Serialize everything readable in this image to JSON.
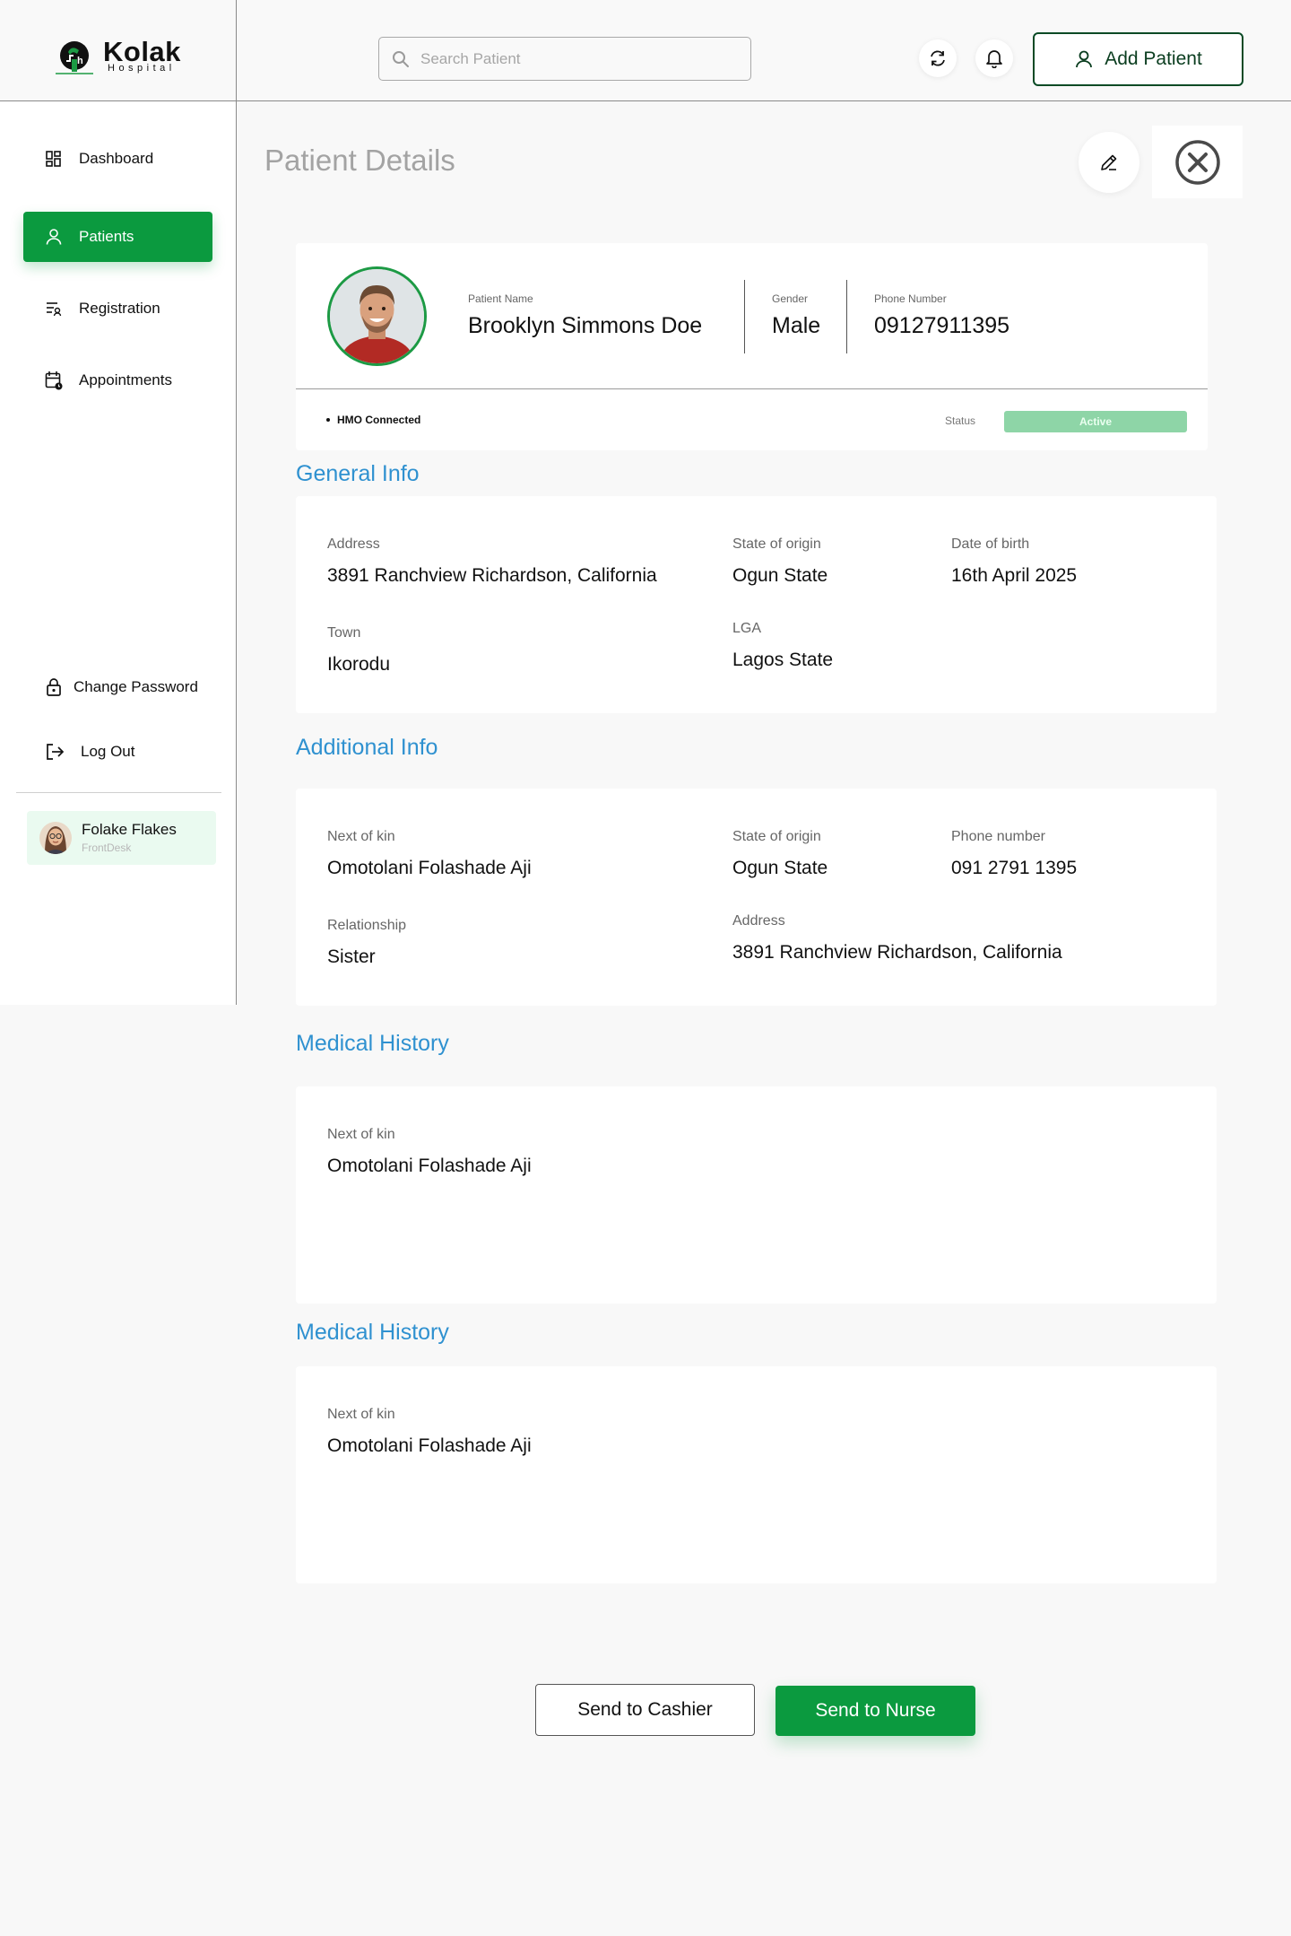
{
  "brand": {
    "name": "Kolak",
    "subtitle": "Hospital",
    "accent": "#0b9a3f"
  },
  "header": {
    "search_placeholder": "Search Patient",
    "add_patient_label": "Add Patient"
  },
  "sidebar": {
    "items": [
      {
        "label": "Dashboard",
        "icon": "dashboard-icon"
      },
      {
        "label": "Patients",
        "icon": "user-icon",
        "active": true
      },
      {
        "label": "Registration",
        "icon": "registration-icon"
      },
      {
        "label": "Appointments",
        "icon": "calendar-icon"
      }
    ],
    "bottom_items": [
      {
        "label": "Change Password",
        "icon": "lock-icon"
      },
      {
        "label": "Log Out",
        "icon": "logout-icon"
      }
    ],
    "user": {
      "name": "Folake Flakes",
      "role": "FrontDesk"
    }
  },
  "page": {
    "title": "Patient Details"
  },
  "patient": {
    "name_label": "Patient Name",
    "name": "Brooklyn Simmons Doe",
    "gender_label": "Gender",
    "gender": "Male",
    "phone_label": "Phone Number",
    "phone": "09127911395",
    "hmo": "HMO Connected",
    "status_label": "Status",
    "status": "Active"
  },
  "general_info": {
    "title": "General Info",
    "address_label": "Address",
    "address": "3891 Ranchview Richardson, California",
    "state_label": "State of origin",
    "state": "Ogun State",
    "dob_label": "Date of birth",
    "dob": "16th April 2025",
    "town_label": "Town",
    "town": "Ikorodu",
    "lga_label": "LGA",
    "lga": "Lagos State"
  },
  "additional_info": {
    "title": "Additional Info",
    "kin_label": "Next of kin",
    "kin": "Omotolani Folashade Aji",
    "state_label": "State of origin",
    "state": "Ogun State",
    "phone_label": "Phone number",
    "phone": "091 2791 1395",
    "relationship_label": "Relationship",
    "relationship": "Sister",
    "address_label": "Address",
    "address": "3891 Ranchview Richardson, California"
  },
  "medical_history": [
    {
      "title": "Medical History",
      "kin_label": "Next of kin",
      "kin": "Omotolani Folashade Aji"
    },
    {
      "title": "Medical History",
      "kin_label": "Next of kin",
      "kin": "Omotolani Folashade Aji"
    }
  ],
  "actions": {
    "cashier": "Send to Cashier",
    "nurse": "Send to Nurse"
  }
}
